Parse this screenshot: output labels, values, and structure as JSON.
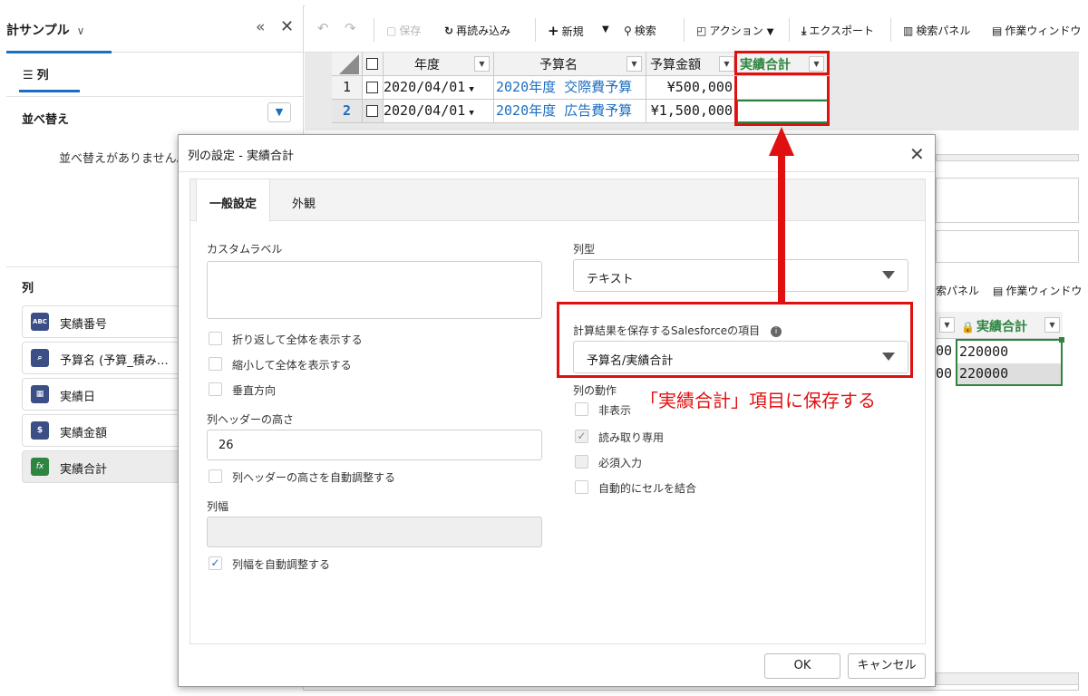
{
  "left_panel": {
    "title": "計サンプル",
    "columns_tab": "列",
    "sort_label": "並べ替え",
    "no_sort_message": "並べ替えがありません。",
    "columns_header": "列",
    "column_items": [
      {
        "label": "実績番号",
        "icon": "text-type-icon",
        "icon_text": "ABC",
        "color": "#3b4f86"
      },
      {
        "label": "予算名 (予算_積み…",
        "icon": "lookup-icon",
        "icon_text": "⌕",
        "color": "#3b4f86"
      },
      {
        "label": "実績日",
        "icon": "calendar-icon",
        "icon_text": "▦",
        "color": "#3b4f86"
      },
      {
        "label": "実績金額",
        "icon": "money-bag-icon",
        "icon_text": "$",
        "color": "#3b4f86"
      },
      {
        "label": "実績合計",
        "icon": "formula-icon",
        "icon_text": "fx",
        "color": "#2e8540"
      }
    ]
  },
  "toolbar": {
    "save": "保存",
    "reload": "再読み込み",
    "new": "新規",
    "search": "検索",
    "action": "アクション",
    "export": "エクスポート",
    "search_panel": "検索パネル",
    "work_window": "作業ウィンドウ"
  },
  "grid": {
    "headers": [
      "年度",
      "予算名",
      "予算金額",
      "実績合計"
    ],
    "rows": [
      {
        "num": "1",
        "date": "2020/04/01",
        "name": "2020年度 交際費予算",
        "amount": "¥500,000",
        "total": ""
      },
      {
        "num": "2",
        "date": "2020/04/01",
        "name": "2020年度 広告費予算",
        "amount": "¥1,500,000",
        "total": ""
      }
    ]
  },
  "background_grid": {
    "search_panel_fragment": "索パネル",
    "work_window": "作業ウィンドウ",
    "header": "実績合計",
    "values": [
      "220000",
      "220000"
    ],
    "left_fragment": [
      "00",
      "00"
    ]
  },
  "modal": {
    "title": "列の設定 - 実績合計",
    "tabs": [
      "一般設定",
      "外観"
    ],
    "custom_label": "カスタムラベル",
    "wrap_text": "折り返して全体を表示する",
    "shrink_text": "縮小して全体を表示する",
    "vertical": "垂直方向",
    "header_height_label": "列ヘッダーの高さ",
    "header_height_value": "26",
    "auto_header_height": "列ヘッダーの高さを自動調整する",
    "column_width_label": "列幅",
    "auto_width": "列幅を自動調整する",
    "column_type_label": "列型",
    "column_type_value": "テキスト",
    "sf_field_label": "計算結果を保存するSalesforceの項目",
    "sf_field_value": "予算名/実績合計",
    "column_behavior_label": "列の動作",
    "hidden": "非表示",
    "readonly": "読み取り専用",
    "required": "必須入力",
    "merge_cells": "自動的にセルを結合",
    "ok": "OK",
    "cancel": "キャンセル"
  },
  "annotation": "「実績合計」項目に保存する",
  "colors": {
    "accent_blue": "#1b6ec2",
    "annotation_red": "#e01010",
    "highlight_green": "#2e8540"
  }
}
